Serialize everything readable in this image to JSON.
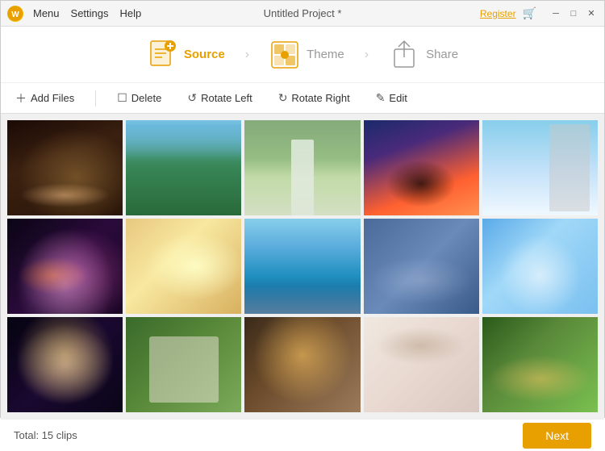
{
  "titlebar": {
    "title": "Untitled Project *",
    "menu": [
      "Menu",
      "Settings",
      "Help"
    ],
    "register": "Register",
    "app_icon_letter": "W"
  },
  "wizard": {
    "steps": [
      {
        "key": "source",
        "label": "Source",
        "active": true
      },
      {
        "key": "theme",
        "label": "Theme",
        "active": false
      },
      {
        "key": "share",
        "label": "Share",
        "active": false
      }
    ]
  },
  "toolbar": {
    "buttons": [
      {
        "key": "add-files",
        "icon": "+",
        "label": "Add Files"
      },
      {
        "key": "delete",
        "icon": "☐",
        "label": "Delete"
      },
      {
        "key": "rotate-left",
        "icon": "↺",
        "label": "Rotate Left"
      },
      {
        "key": "rotate-right",
        "icon": "↻",
        "label": "Rotate Right"
      },
      {
        "key": "edit",
        "icon": "✎",
        "label": "Edit"
      }
    ]
  },
  "gallery": {
    "items": [
      {
        "id": 1,
        "selected": true,
        "class": "photo-1"
      },
      {
        "id": 2,
        "selected": true,
        "class": "photo-2"
      },
      {
        "id": 3,
        "selected": true,
        "class": "photo-3"
      },
      {
        "id": 4,
        "selected": false,
        "class": "photo-4"
      },
      {
        "id": 5,
        "selected": false,
        "class": "photo-5"
      },
      {
        "id": 6,
        "selected": false,
        "class": "photo-6"
      },
      {
        "id": 7,
        "selected": false,
        "class": "photo-7"
      },
      {
        "id": 8,
        "selected": false,
        "class": "photo-8"
      },
      {
        "id": 9,
        "selected": false,
        "class": "photo-9"
      },
      {
        "id": 10,
        "selected": false,
        "class": "photo-10"
      },
      {
        "id": 11,
        "selected": false,
        "class": "photo-11"
      },
      {
        "id": 12,
        "selected": false,
        "class": "photo-12"
      },
      {
        "id": 13,
        "selected": false,
        "class": "photo-13"
      },
      {
        "id": 14,
        "selected": false,
        "class": "photo-14"
      },
      {
        "id": 15,
        "selected": false,
        "class": "photo-15"
      }
    ]
  },
  "bottombar": {
    "total": "Total: 15 clips",
    "next_label": "Next"
  }
}
